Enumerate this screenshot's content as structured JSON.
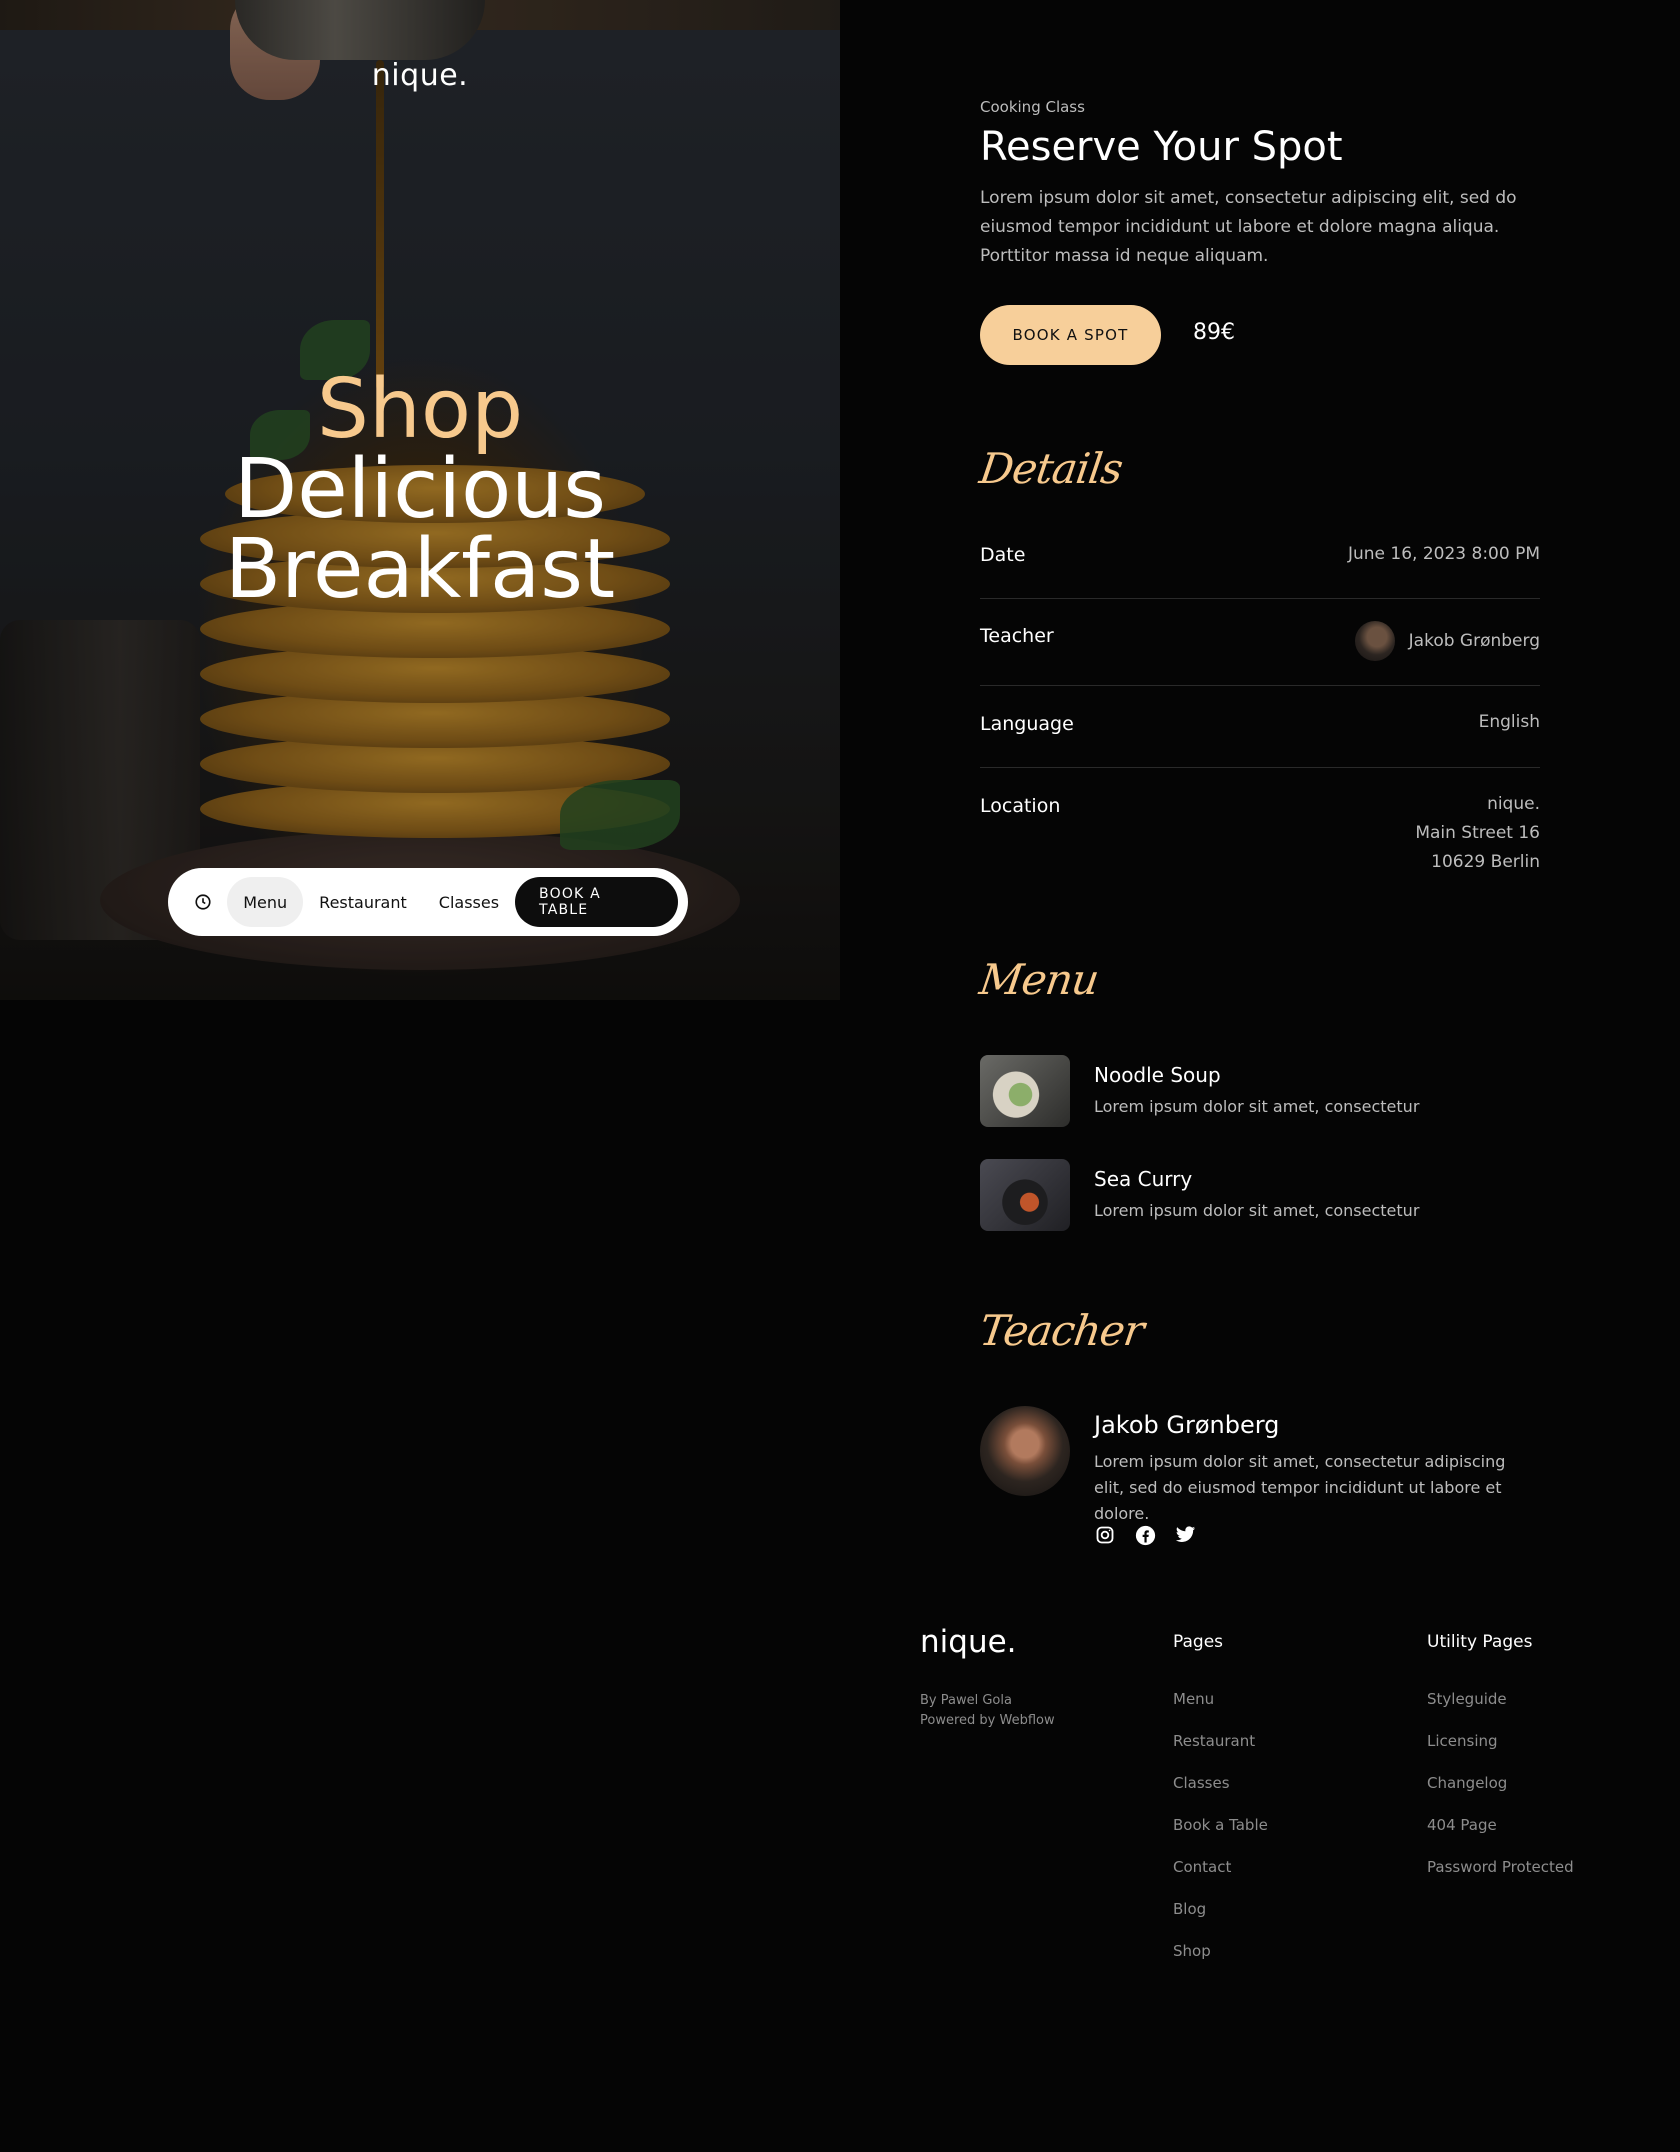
{
  "brand": {
    "logo": "nique."
  },
  "hero": {
    "line1": "Shop",
    "line2": "Delicious",
    "line3": "Breakfast"
  },
  "nav": {
    "items": [
      {
        "label": "Menu",
        "active": true
      },
      {
        "label": "Restaurant",
        "active": false
      },
      {
        "label": "Classes",
        "active": false
      }
    ],
    "cta": "BOOK A TABLE",
    "clock_icon": "clock-icon"
  },
  "class": {
    "eyebrow": "Cooking Class",
    "title": "Reserve Your Spot",
    "intro": "Lorem ipsum dolor sit amet, consectetur adipiscing elit, sed do eiusmod tempor incididunt ut labore et dolore magna aliqua. Porttitor massa id neque aliquam.",
    "button": "BOOK A SPOT",
    "price": "89€"
  },
  "details": {
    "heading": "Details",
    "date_label": "Date",
    "date_value": "June 16, 2023 8:00 PM",
    "teacher_label": "Teacher",
    "teacher_value": "Jakob Grønberg",
    "language_label": "Language",
    "language_value": "English",
    "location_label": "Location",
    "location_line1": "nique.",
    "location_line2": "Main Street 16",
    "location_line3": "10629 Berlin"
  },
  "menu": {
    "heading": "Menu",
    "items": [
      {
        "title": "Noodle Soup",
        "desc": "Lorem ipsum dolor sit amet, consectetur"
      },
      {
        "title": "Sea Curry",
        "desc": "Lorem ipsum dolor sit amet, consectetur"
      }
    ]
  },
  "teacher": {
    "heading": "Teacher",
    "name": "Jakob Grønberg",
    "bio": "Lorem ipsum dolor sit amet, consectetur adipiscing elit, sed do eiusmod tempor incididunt ut labore et dolore.",
    "socials": [
      "instagram-icon",
      "facebook-icon",
      "twitter-icon"
    ]
  },
  "footer": {
    "logo": "nique.",
    "by": "By Pawel Gola",
    "powered": "Powered by Webflow",
    "pages_heading": "Pages",
    "pages": [
      "Menu",
      "Restaurant",
      "Classes",
      "Book a Table",
      "Contact",
      "Blog",
      "Shop"
    ],
    "utility_heading": "Utility Pages",
    "utility": [
      "Styleguide",
      "Licensing",
      "Changelog",
      "404 Page",
      "Password Protected"
    ]
  },
  "colors": {
    "background": "#050505",
    "accent": "#f7c98d",
    "button": "#f7cf9a",
    "muted_text": "#bdbdbd"
  }
}
